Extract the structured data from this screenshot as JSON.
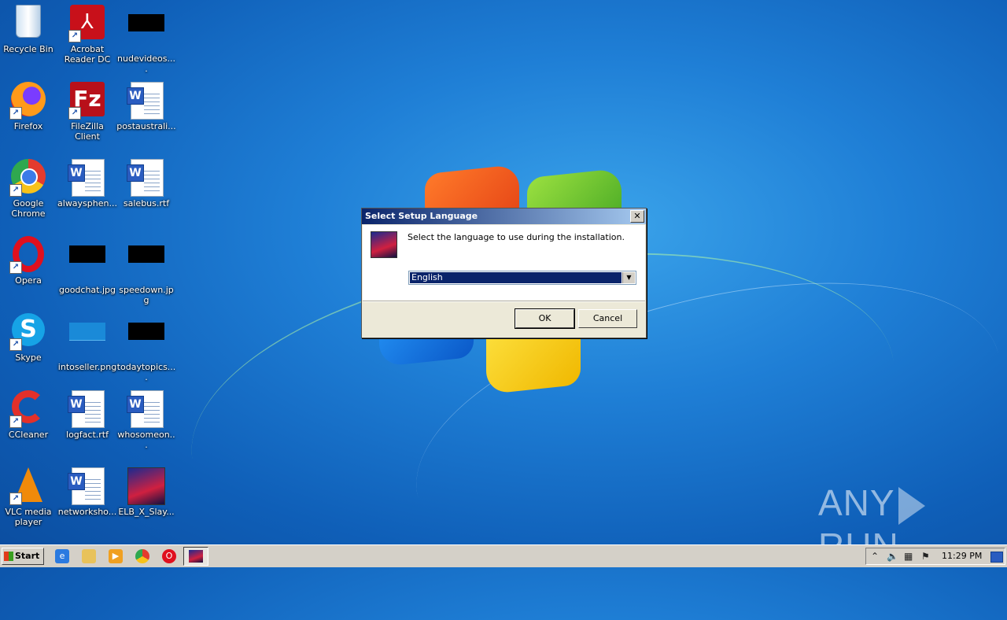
{
  "desktop": {
    "icons": [
      {
        "label": "Recycle Bin",
        "icon": "recycle-bin-icon"
      },
      {
        "label": "Acrobat Reader DC",
        "icon": "acrobat-icon"
      },
      {
        "label": "nudevideos....",
        "icon": "black-thumbnail-icon"
      },
      {
        "label": "Firefox",
        "icon": "firefox-icon"
      },
      {
        "label": "FileZilla Client",
        "icon": "filezilla-icon"
      },
      {
        "label": "postaustrali...",
        "icon": "word-doc-icon"
      },
      {
        "label": "Google Chrome",
        "icon": "chrome-icon"
      },
      {
        "label": "alwaysphen...",
        "icon": "word-doc-icon"
      },
      {
        "label": "salebus.rtf",
        "icon": "word-doc-icon"
      },
      {
        "label": "Opera",
        "icon": "opera-icon"
      },
      {
        "label": "goodchat.jpg",
        "icon": "black-thumbnail-icon"
      },
      {
        "label": "speedown.jpg",
        "icon": "black-thumbnail-icon"
      },
      {
        "label": "Skype",
        "icon": "skype-icon"
      },
      {
        "label": "intoseller.png",
        "icon": "blue-thumbnail-icon"
      },
      {
        "label": "todaytopics....",
        "icon": "black-thumbnail-icon"
      },
      {
        "label": "CCleaner",
        "icon": "ccleaner-icon"
      },
      {
        "label": "logfact.rtf",
        "icon": "word-doc-icon"
      },
      {
        "label": "whosomeon...",
        "icon": "word-doc-icon"
      },
      {
        "label": "VLC media player",
        "icon": "vlc-icon"
      },
      {
        "label": "networksho...",
        "icon": "word-doc-icon"
      },
      {
        "label": "ELB_X_Slay...",
        "icon": "setup-app-icon"
      }
    ]
  },
  "dialog": {
    "title": "Select Setup Language",
    "close_glyph": "✕",
    "message": "Select the language to use during the installation.",
    "language_selected": "English",
    "ok_label": "OK",
    "cancel_label": "Cancel"
  },
  "taskbar": {
    "start_label": "Start",
    "clock": "11:29 PM",
    "pinned": [
      "internet-explorer-icon",
      "explorer-folder-icon",
      "media-player-icon",
      "chrome-icon",
      "opera-icon"
    ]
  },
  "watermark": {
    "left": "ANY",
    "right": "RUN"
  }
}
